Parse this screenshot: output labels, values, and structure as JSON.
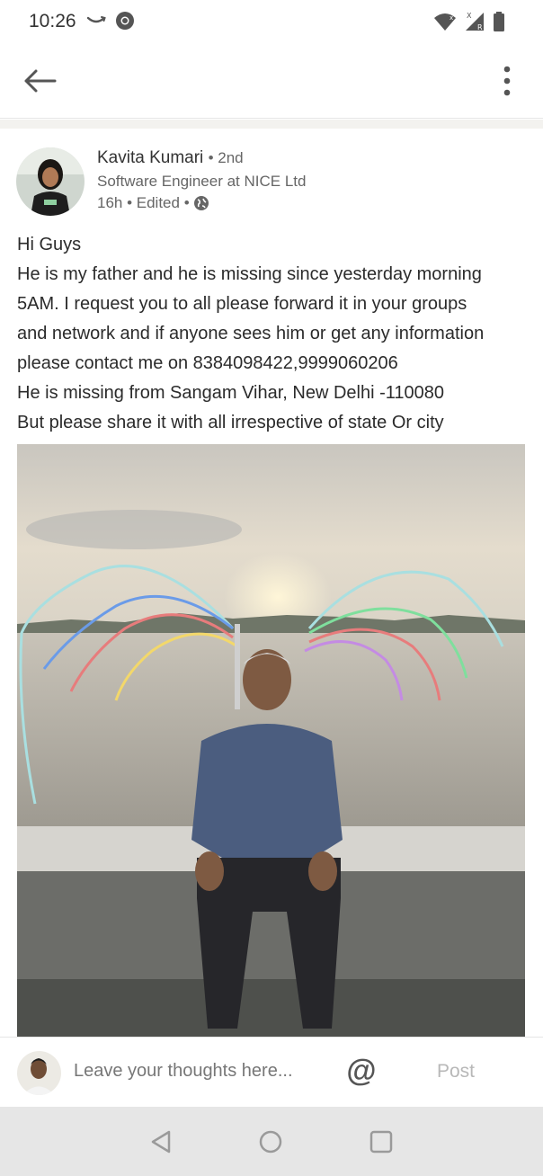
{
  "status_bar": {
    "time": "10:26",
    "left_icons": [
      "amazon-smile-icon",
      "chrome-icon"
    ],
    "right_icons": [
      "wifi-icon",
      "signal-icon",
      "battery-icon"
    ]
  },
  "app_bar": {
    "icons": [
      "back-arrow-icon",
      "more-vertical-icon"
    ]
  },
  "post": {
    "author": {
      "name": "Kavita Kumari",
      "degree": "• 2nd",
      "headline": "Software Engineer at NICE Ltd",
      "time": "16h • Edited •",
      "visibility_icon": "globe-icon"
    },
    "text_lines": [
      "Hi Guys",
      "He is my father and he is missing since yesterday morning",
      "5AM. I request you to all please forward it in your groups",
      "and network and if anyone sees him or get any information",
      "please contact me on 8384098422,9999060206",
      "He is missing from Sangam Vihar, New Delhi -110080",
      "But please share it with all irrespective of state Or city"
    ]
  },
  "comment_bar": {
    "placeholder": "Leave your thoughts here...",
    "mention_symbol": "@",
    "post_label": "Post"
  },
  "nav_bar": {
    "icons": [
      "back-triangle-icon",
      "home-circle-icon",
      "recents-square-icon"
    ]
  },
  "colors": {
    "background": "#f3f2ef",
    "nav_bar": "#e6e6e6",
    "post_disabled": "#b8b8b8"
  }
}
